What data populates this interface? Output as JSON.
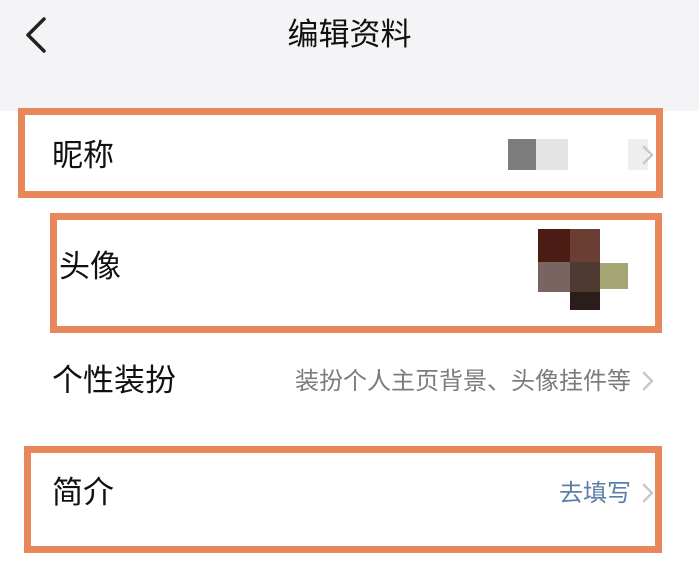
{
  "header": {
    "title": "编辑资料",
    "back_icon": "chevron-left-icon"
  },
  "rows": [
    {
      "label": "昵称",
      "value": ""
    },
    {
      "label": "头像",
      "value": ""
    },
    {
      "label": "个性装扮",
      "value": "装扮个人主页背景、头像挂件等"
    },
    {
      "label": "简介",
      "value": "去填写"
    }
  ],
  "colors": {
    "highlight": "#e8885a",
    "link": "#5b7fa6",
    "secondary_text": "#7c7c7c",
    "background": "#f4f4f6"
  }
}
